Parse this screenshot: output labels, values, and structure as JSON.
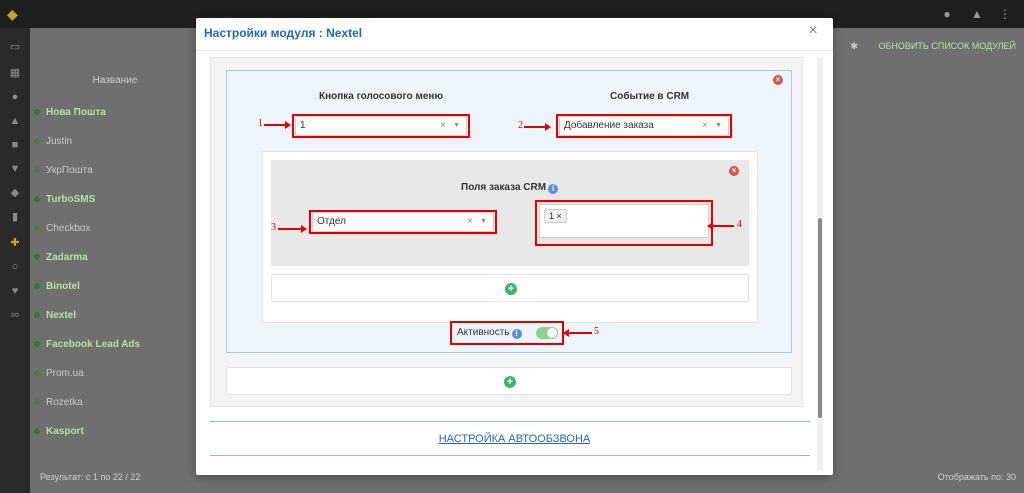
{
  "modal": {
    "title": "Настройки модуля : Nextel",
    "close_glyph": "×",
    "col1_label": "Кнопка голосового меню",
    "col2_label": "Событие в CRM",
    "voice_button_value": "1",
    "crm_event_value": "Добавление заказа",
    "order_fields_label": "Поля заказа CRM",
    "field_select_value": "Отдел",
    "tag_value": "1",
    "activity_label": "Активность",
    "footer_link": "НАСТРОЙКА АВТООБЗВОНА",
    "clear_glyph": "×",
    "arrow_glyph": "▼",
    "remove_glyph": "×",
    "info_glyph": "i",
    "plus_glyph": "+"
  },
  "annotations": [
    "1",
    "2",
    "3",
    "4",
    "5"
  ],
  "background": {
    "header": "Название",
    "items": [
      {
        "label": "Нова Пошта",
        "active": true
      },
      {
        "label": "Justin",
        "active": false
      },
      {
        "label": "УкрПошта",
        "active": false
      },
      {
        "label": "TurboSMS",
        "active": true
      },
      {
        "label": "Checkbox",
        "active": false
      },
      {
        "label": "Zadarma",
        "active": true
      },
      {
        "label": "Binotel",
        "active": true
      },
      {
        "label": "Nextel",
        "active": true
      },
      {
        "label": "Facebook Lead Ads",
        "active": true
      },
      {
        "label": "Prom.ua",
        "active": false
      },
      {
        "label": "Rozetka",
        "active": false
      },
      {
        "label": "Kasport",
        "active": true
      }
    ],
    "refresh_label": "ОБНОВИТЬ СПИСОК МОДУЛЕЙ",
    "results_text": "Результат: с 1 по 22 / 22",
    "per_page_label": "Отображать по:",
    "per_page_value": "30"
  },
  "colors": {
    "accent_blue": "#2569b3",
    "annotation_red": "#e30000",
    "toggle_green": "#8fd18f",
    "add_green": "#3cb371"
  }
}
